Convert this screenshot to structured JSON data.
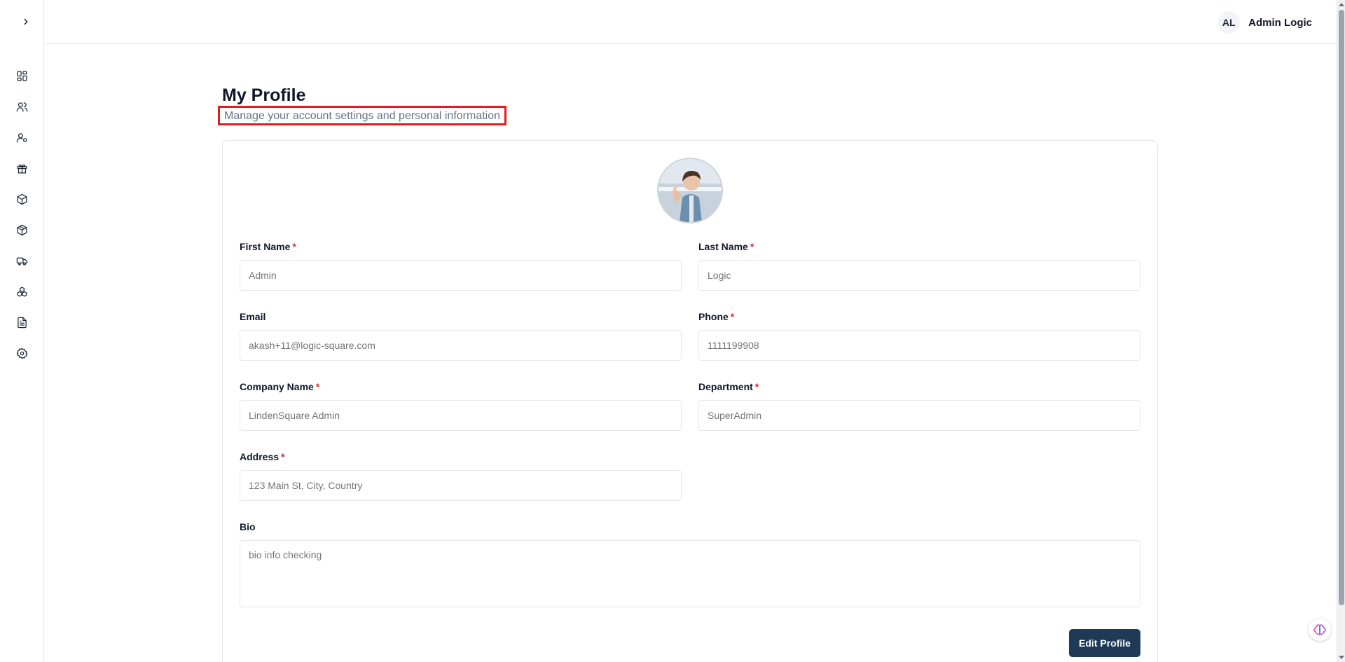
{
  "header": {
    "user_initials": "AL",
    "user_name": "Admin Logic"
  },
  "sidebar": {
    "toggle_icon": "chevron-right-icon",
    "items": [
      {
        "icon": "dashboard-icon"
      },
      {
        "icon": "users-icon"
      },
      {
        "icon": "user-settings-icon"
      },
      {
        "icon": "gift-icon"
      },
      {
        "icon": "package-icon"
      },
      {
        "icon": "box-icon"
      },
      {
        "icon": "truck-icon"
      },
      {
        "icon": "boxes-icon"
      },
      {
        "icon": "document-icon"
      },
      {
        "icon": "settings-icon"
      }
    ]
  },
  "page": {
    "title": "My Profile",
    "subtitle": "Manage your account settings and personal information"
  },
  "form": {
    "first_name": {
      "label": "First Name",
      "required": "*",
      "placeholder": "Admin"
    },
    "last_name": {
      "label": "Last Name",
      "required": "*",
      "placeholder": "Logic"
    },
    "email": {
      "label": "Email",
      "placeholder": "akash+11@logic-square.com"
    },
    "phone": {
      "label": "Phone",
      "required": "*",
      "placeholder": "1111199908"
    },
    "company": {
      "label": "Company Name",
      "required": "*",
      "placeholder": "LindenSquare Admin"
    },
    "department": {
      "label": "Department",
      "required": "*",
      "placeholder": "SuperAdmin"
    },
    "address": {
      "label": "Address",
      "required": "*",
      "placeholder": "123 Main St, City, Country"
    },
    "bio": {
      "label": "Bio",
      "placeholder": "bio info checking"
    },
    "edit_label": "Edit Profile"
  },
  "colors": {
    "accent": "#1e3a56",
    "required": "#dc2626",
    "highlight": "#e11d1d"
  }
}
